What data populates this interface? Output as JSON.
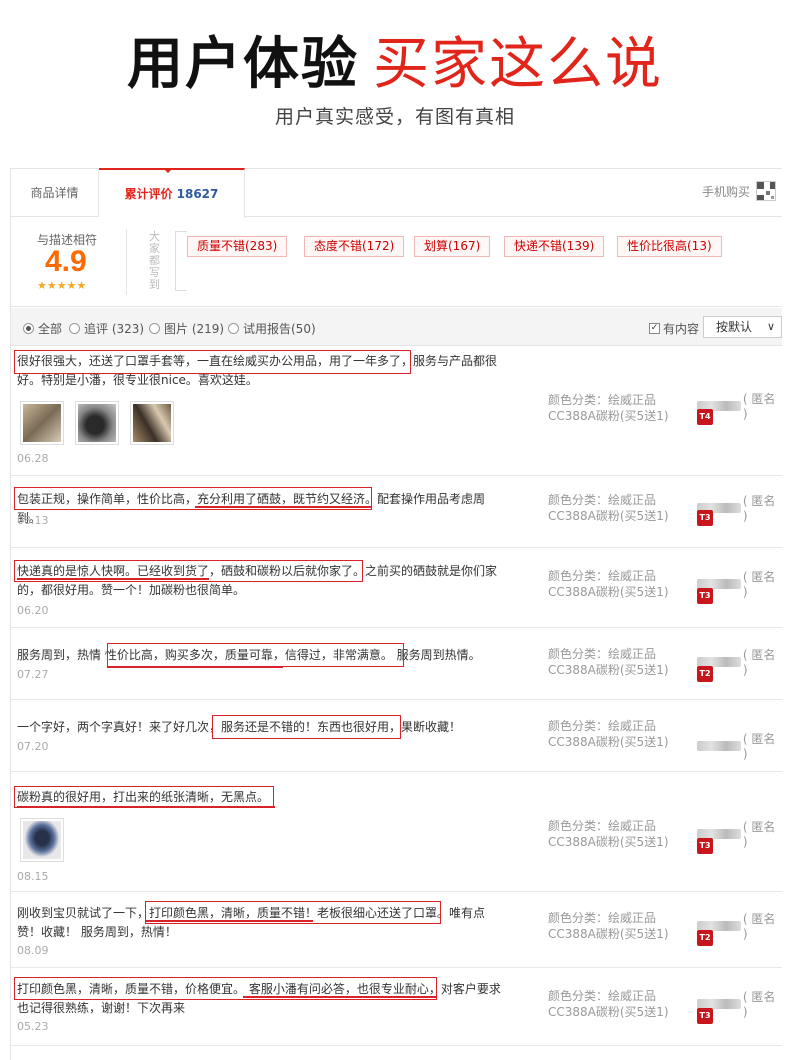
{
  "hero": {
    "title_bold": "用户体验",
    "title_red": "买家这么说",
    "subtitle": "用户真实感受，有图有真相"
  },
  "tabs": {
    "detail": "商品详情",
    "reviews_label": "累计评价",
    "reviews_count": "18627",
    "mobile_buy": "手机购买"
  },
  "summary": {
    "label": "与描述相符",
    "score": "4.9",
    "stars": "★★★★★",
    "vertical_label": "大家都写到",
    "tags": [
      "质量不错(283)",
      "态度不错(172)",
      "划算(167)",
      "快递不错(139)",
      "性价比很高(13)"
    ]
  },
  "filter": {
    "options": [
      "全部",
      "追评 (323)",
      "图片 (219)",
      "试用报告(50)"
    ],
    "has_content": "有内容",
    "sort": "按默认"
  },
  "reviews": [
    {
      "text": "很好很强大，还送了口罩手套等，一直在绘威买办公用品，用了一年多了，服务与产品都很好。特别是小潘，很专业很nice。喜欢这娃。",
      "date": "06.28",
      "level": "T4"
    },
    {
      "text": "包装正规，操作简单，性价比高，充分利用了硒鼓，既节约又经济。配套操作用品考虑周到。",
      "date": "08.13",
      "level": "T3"
    },
    {
      "text": "快递真的是惊人快啊。已经收到货了，硒鼓和碳粉以后就你家了。之前买的硒鼓就是你们家的，都很好用。赞一个！加碳粉也很简单。",
      "date": "06.20",
      "level": "T3"
    },
    {
      "text": "服务周到，热情  性价比高，购买多次，质量可靠，信得过，非常满意。 服务周到热情。",
      "date": "07.27",
      "level": "T2"
    },
    {
      "text": "一个字好，两个字真好！来了好几次，服务还是不错的！东西也很好用，果断收藏！",
      "date": "07.20",
      "level": ""
    },
    {
      "text": "碳粉真的很好用，打出来的纸张清晰，无黑点。",
      "date": "08.15",
      "level": "T3"
    },
    {
      "text": "刚收到宝贝就试了一下，打印颜色黑，清晰，质量不错！老板很细心还送了口罩。唯有点赞！收藏！ 服务周到，热情！",
      "date": "08.09",
      "level": "T2"
    },
    {
      "text": "打印颜色黑，清晰，质量不错，价格便宜。 客服小潘有问必答，也很专业耐心，对客户要求也记得很熟练，谢谢！下次再来",
      "date": "05.23",
      "level": "T3"
    }
  ],
  "meta": {
    "line1": "颜色分类：绘威正品",
    "line2": "CC388A碳粉(买5送1)",
    "anon": "( 匿名 )"
  }
}
